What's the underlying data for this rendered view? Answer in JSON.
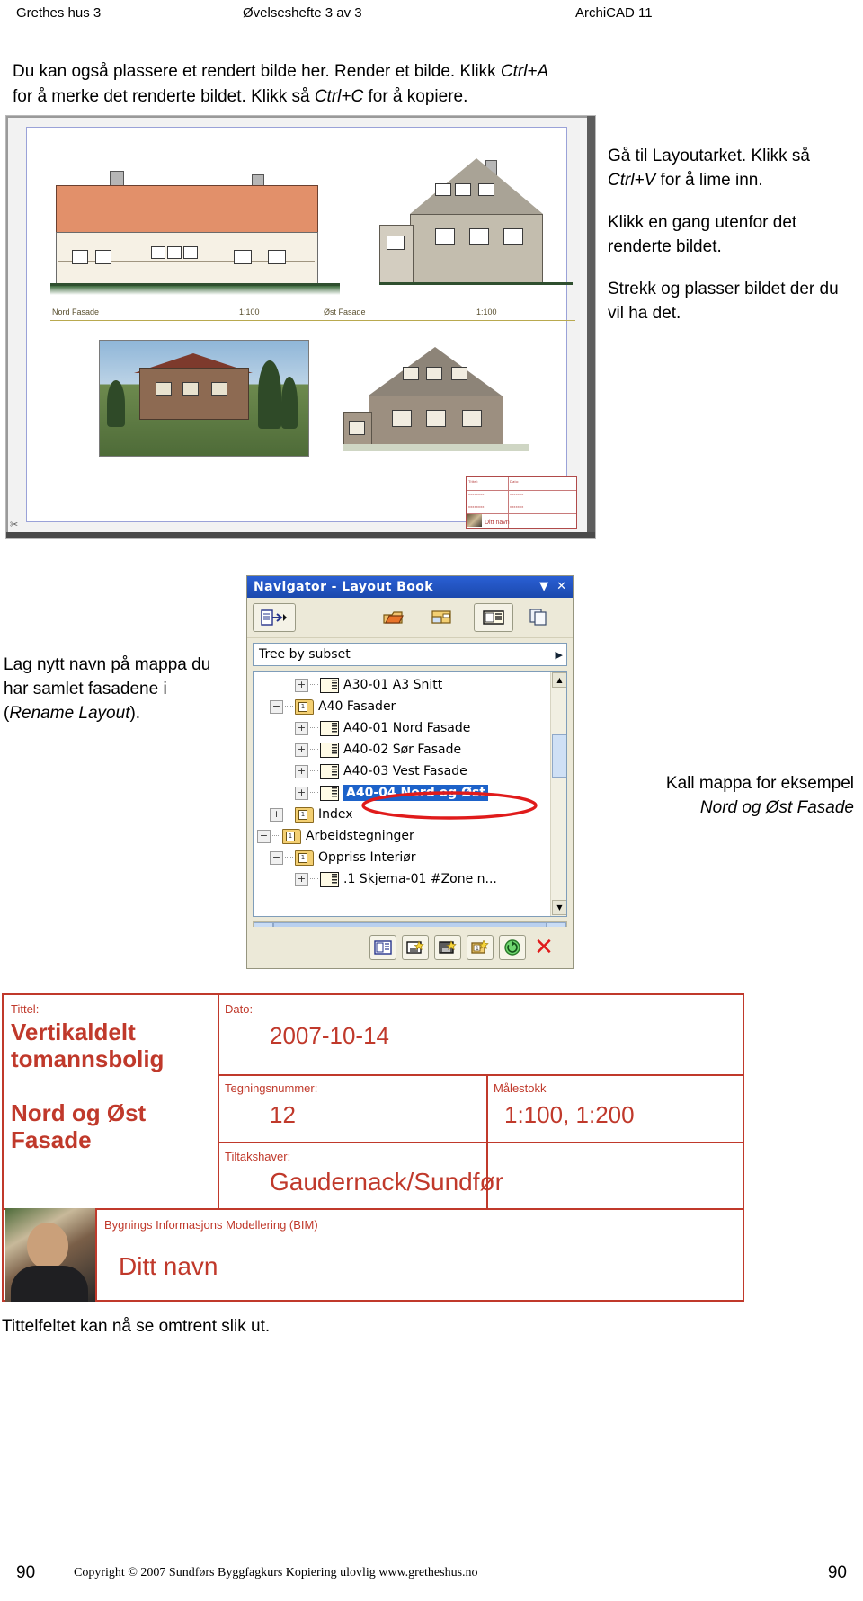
{
  "runninghead": {
    "left": "Grethes hus 3",
    "middle": "Øvelseshefte 3 av 3",
    "right": "ArchiCAD 11"
  },
  "intro": {
    "l1a": "Du kan også plassere et rendert bilde her.  Render et bilde.  Klikk ",
    "l1b": "Ctrl+A",
    "l2a": "for å merke det renderte bildet.  Klikk så ",
    "l2b": "Ctrl+C",
    "l2c": " for å kopiere."
  },
  "layout_screenshot": {
    "north_caption": "Nord Fasade",
    "north_scale": "1:100",
    "east_caption": "Øst Fasade",
    "east_scale": "1:100",
    "mini_titleblock": {
      "name": "Ditt navn"
    }
  },
  "right_column": {
    "p1a": "Gå til Layoutarket. Klikk så ",
    "p1b": "Ctrl+V",
    "p1c": " for å lime inn.",
    "p2": "Klikk en gang utenfor det renderte bildet.",
    "p3": "Strekk og plasser bildet der du vil ha det."
  },
  "nav_left_note": {
    "a": "Lag nytt navn på mappa du har samlet fasadene i (",
    "b": "Rename Layout",
    "c": ")."
  },
  "nav_right_note": {
    "a": "Kall mappa for eksempel ",
    "b": "Nord og Øst Fasade"
  },
  "navigator": {
    "title": "Navigator - Layout Book",
    "title_buttons": [
      "▼",
      "✕"
    ],
    "toolbar_icons": [
      "publish-icon",
      "open-project-icon",
      "layout-book-icon",
      "layout-view-icon",
      "copy-icon"
    ],
    "combo_value": "Tree by subset",
    "combo_arrow": "▶",
    "tree": [
      {
        "indent": 2,
        "expander": "+",
        "icon": "sheet",
        "label": "A30-01 A3 Snitt",
        "selected": false
      },
      {
        "indent": 1,
        "expander": "−",
        "icon": "folder",
        "label": "A40 Fasader",
        "selected": false
      },
      {
        "indent": 2,
        "expander": "+",
        "icon": "sheet",
        "label": "A40-01 Nord Fasade",
        "selected": false
      },
      {
        "indent": 2,
        "expander": "+",
        "icon": "sheet",
        "label": "A40-02 Sør Fasade",
        "selected": false
      },
      {
        "indent": 2,
        "expander": "+",
        "icon": "sheet",
        "label": "A40-03 Vest Fasade",
        "selected": false
      },
      {
        "indent": 2,
        "expander": "+",
        "icon": "sheet",
        "label": "A40-04 Nord og Øst",
        "selected": true
      },
      {
        "indent": 1,
        "expander": "+",
        "icon": "folder",
        "label": "Index",
        "selected": false
      },
      {
        "indent": 0,
        "expander": "−",
        "icon": "folder",
        "label": "Arbeidstegninger",
        "selected": false
      },
      {
        "indent": 1,
        "expander": "−",
        "icon": "folder",
        "label": "Oppriss Interiør",
        "selected": false
      },
      {
        "indent": 2,
        "expander": "+",
        "icon": "sheet",
        "label": ".1 Skjema-01 #Zone n...",
        "selected": false
      }
    ],
    "hscroll": {
      "left": "◀",
      "grip": "||||",
      "right": "▶"
    },
    "vscroll": {
      "up": "▲",
      "down": "▼"
    },
    "bottom_icons": [
      "new-master-layout-icon",
      "new-layout-icon",
      "new-layout-dark-icon",
      "new-subset-icon",
      "update-icon",
      "delete-icon"
    ],
    "delete_glyph": "✕",
    "accent_blue": "#1d62c9",
    "annotation_color": "#e01b1b"
  },
  "titleblock": {
    "label_tittel": "Tittel:",
    "title_line1": "Vertikaldelt",
    "title_line2": "tomannsbolig",
    "title_line3": "Nord og Øst",
    "title_line4": "Fasade",
    "label_dato": "Dato:",
    "dato": "2007-10-14",
    "label_tegningsnummer": "Tegningsnummer:",
    "tegningsnummer": "12",
    "label_malestokk": "Målestokk",
    "malestokk": "1:100, 1:200",
    "label_tiltakshaver": "Tiltakshaver:",
    "tiltakshaver": "Gaudernack/Sundfør",
    "bim_label": "Bygnings Informasjons Modellering (BIM)",
    "name": "Ditt navn",
    "color": "#c0392b"
  },
  "caption_after": "Tittelfeltet kan nå se omtrent slik ut.",
  "footer": {
    "page_left": "90",
    "page_right": "90",
    "copyright": "Copyright © 2007   Sundførs Byggfagkurs    Kopiering ulovlig   www.gretheshus.no"
  }
}
